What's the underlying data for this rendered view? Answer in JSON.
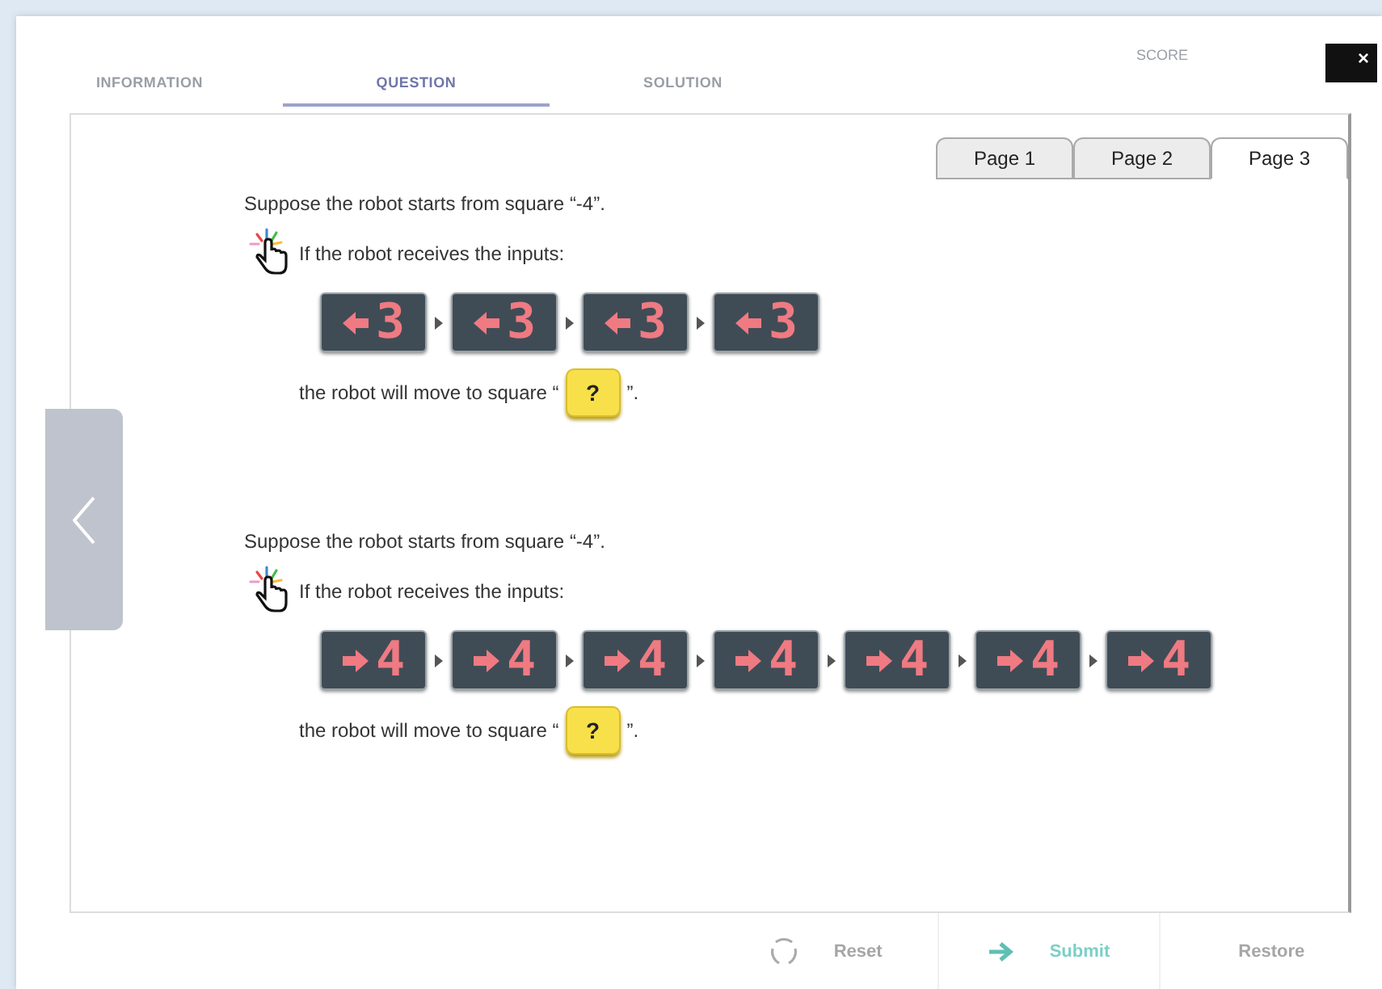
{
  "tabs": [
    {
      "label": "INFORMATION",
      "selected": false
    },
    {
      "label": "QUESTION",
      "selected": true
    },
    {
      "label": "SOLUTION",
      "selected": false
    }
  ],
  "score_label": "SCORE",
  "close": "×",
  "pages": [
    {
      "label": "Page 1",
      "selected": false
    },
    {
      "label": "Page 2",
      "selected": false
    },
    {
      "label": "Page 3",
      "selected": true
    }
  ],
  "questions": [
    {
      "intro": "Suppose the robot starts from square “-4”.",
      "prompt": "If the robot receives the inputs:",
      "inputs": [
        {
          "kind": "left",
          "value": "3"
        },
        {
          "kind": "left",
          "value": "3"
        },
        {
          "kind": "left",
          "value": "3"
        },
        {
          "kind": "left",
          "value": "3"
        }
      ],
      "answer_before": "the robot will move to square “",
      "answer": "?",
      "answer_after": "”."
    },
    {
      "intro": "Suppose the robot starts from square “-4”.",
      "prompt": "If the robot receives the inputs:",
      "inputs": [
        {
          "kind": "right",
          "value": "4"
        },
        {
          "kind": "right",
          "value": "4"
        },
        {
          "kind": "right",
          "value": "4"
        },
        {
          "kind": "right",
          "value": "4"
        },
        {
          "kind": "right",
          "value": "4"
        },
        {
          "kind": "right",
          "value": "4"
        },
        {
          "kind": "right",
          "value": "4"
        }
      ],
      "answer_before": "the robot will move to square “",
      "answer": "?",
      "answer_after": "”."
    }
  ],
  "footer_buttons": [
    {
      "label": "Reset",
      "kind": "reset"
    },
    {
      "label": "Submit",
      "kind": "submit"
    },
    {
      "label": "Restore",
      "kind": "restore"
    }
  ]
}
